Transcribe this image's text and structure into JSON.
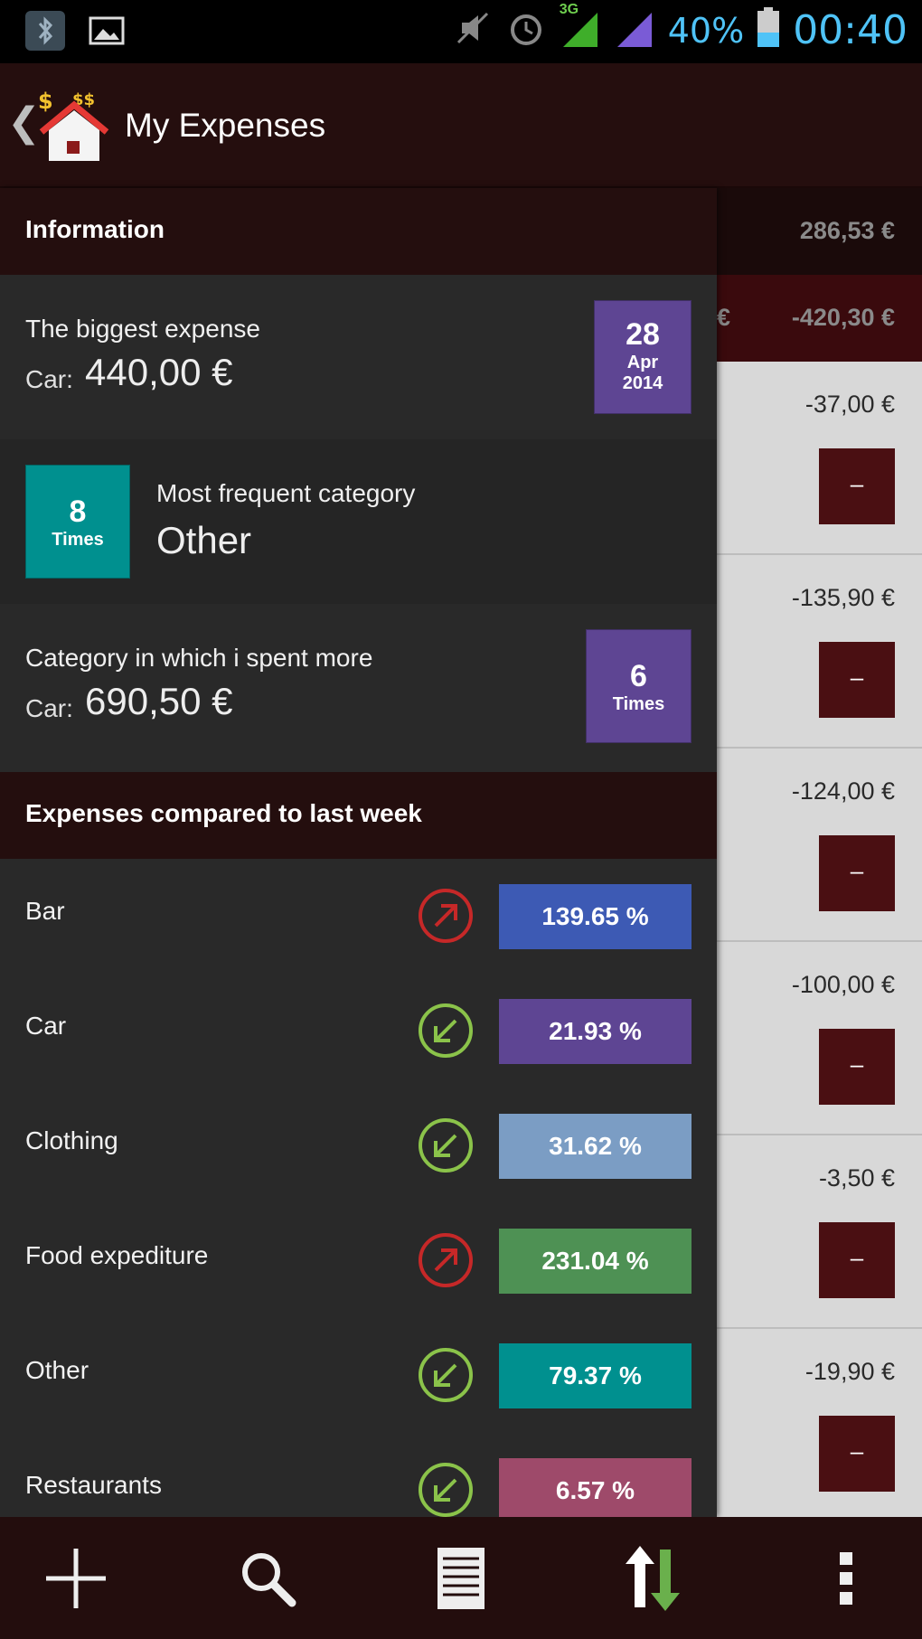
{
  "status_bar": {
    "battery_percent": "40%",
    "time": "00:40",
    "network": "3G",
    "icons": [
      "bluetooth-icon",
      "image-icon",
      "mute-icon",
      "alarm-icon",
      "signal-3g-icon",
      "signal-icon",
      "battery-icon"
    ]
  },
  "action_bar": {
    "title": "My Expenses",
    "back_icon": "chevron-left-icon",
    "app_icon": "house-money-icon"
  },
  "drawer": {
    "information_header": "Information",
    "biggest_expense": {
      "title": "The biggest expense",
      "category": "Car:",
      "amount": "440,00 €",
      "date_day": "28",
      "date_month": "Apr",
      "date_year": "2014",
      "color": "#5e4593"
    },
    "most_frequent": {
      "count": "8",
      "count_label": "Times",
      "title": "Most frequent category",
      "category": "Other",
      "color": "#00908f"
    },
    "spent_more": {
      "title": "Category in which i spent more",
      "category": "Car:",
      "amount": "690,50 €",
      "count": "6",
      "count_label": "Times",
      "color": "#5e4593"
    },
    "comparison_header": "Expenses compared to last week",
    "comparison": [
      {
        "name": "Bar",
        "percent": "139.65 %",
        "trend": "up",
        "color": "#3d5ab4"
      },
      {
        "name": "Car",
        "percent": "21.93 %",
        "trend": "down",
        "color": "#5e4593"
      },
      {
        "name": "Clothing",
        "percent": "31.62 %",
        "trend": "down",
        "color": "#7b9dc4"
      },
      {
        "name": "Food expediture",
        "percent": "231.04 %",
        "trend": "up",
        "color": "#4e9154"
      },
      {
        "name": "Other",
        "percent": "79.37 %",
        "trend": "down",
        "color": "#00908f"
      },
      {
        "name": "Restaurants",
        "percent": "6.57 %",
        "trend": "down",
        "color": "#9e4a6a"
      }
    ]
  },
  "background_list": {
    "total": "286,53 €",
    "week_row_prefix": "€",
    "week_total": "-420,30 €",
    "rows": [
      {
        "amount": "-37,00 €",
        "minus": "–"
      },
      {
        "amount": "-135,90 €",
        "minus": "–"
      },
      {
        "amount": "-124,00 €",
        "minus": "–"
      },
      {
        "amount": "-100,00 €",
        "minus": "–"
      },
      {
        "amount": "-3,50 €",
        "minus": "–"
      },
      {
        "amount": "-19,90 €",
        "minus": "–"
      }
    ]
  },
  "toolbar": {
    "buttons": [
      "add-icon",
      "search-icon",
      "list-icon",
      "sort-icon",
      "overflow-menu-icon"
    ]
  },
  "colors": {
    "up_trend": "#c62828",
    "down_trend": "#8bc34a",
    "header_bg": "#240e0e",
    "drawer_bg": "#292929"
  }
}
